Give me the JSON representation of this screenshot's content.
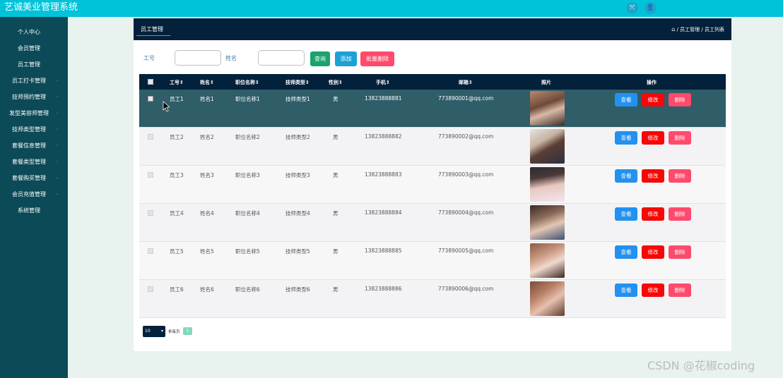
{
  "app": {
    "title": "艺诚美业管理系统"
  },
  "topbar": {
    "fullscreen_icon": "⤧",
    "user_icon": "👤"
  },
  "sidebar": {
    "items": [
      {
        "label": "个人中心"
      },
      {
        "label": "会员管理"
      },
      {
        "label": "员工管理"
      },
      {
        "label": "员工打卡管理"
      },
      {
        "label": "技师预约管理"
      },
      {
        "label": "发型美容师管理"
      },
      {
        "label": "技师类型管理"
      },
      {
        "label": "套餐信息管理"
      },
      {
        "label": "套餐类型管理"
      },
      {
        "label": "套餐购买管理"
      },
      {
        "label": "会员充值管理"
      },
      {
        "label": "系统管理"
      }
    ]
  },
  "panel": {
    "title": "员工管理",
    "breadcrumb": "/ 员工管理 / 员工列表"
  },
  "search": {
    "id_label": "工号",
    "name_label": "姓名",
    "id_value": "",
    "name_value": "",
    "search_btn": "查询",
    "add_btn": "添加",
    "batch_delete_btn": "批量删除"
  },
  "table": {
    "headers": [
      "工号",
      "姓名",
      "职位名称",
      "技师类型",
      "性别",
      "手机",
      "邮箱",
      "照片",
      "操作"
    ],
    "sort_marker": "⇕",
    "view_label": "查看",
    "edit_label": "修改",
    "delete_label": "删除",
    "rows": [
      {
        "id": "员工1",
        "name": "姓名1",
        "position": "职位名称1",
        "tech_type": "技师类型1",
        "gender": "男",
        "phone": "13823888881",
        "email": "773890001@qq.com"
      },
      {
        "id": "员工2",
        "name": "姓名2",
        "position": "职位名称2",
        "tech_type": "技师类型2",
        "gender": "男",
        "phone": "13823888882",
        "email": "773890002@qq.com"
      },
      {
        "id": "员工3",
        "name": "姓名3",
        "position": "职位名称3",
        "tech_type": "技师类型3",
        "gender": "男",
        "phone": "13823888883",
        "email": "773890003@qq.com"
      },
      {
        "id": "员工4",
        "name": "姓名4",
        "position": "职位名称4",
        "tech_type": "技师类型4",
        "gender": "男",
        "phone": "13823888884",
        "email": "773890004@qq.com"
      },
      {
        "id": "员工5",
        "name": "姓名5",
        "position": "职位名称5",
        "tech_type": "技师类型5",
        "gender": "男",
        "phone": "13823888885",
        "email": "773890005@qq.com"
      },
      {
        "id": "员工6",
        "name": "姓名6",
        "position": "职位名称6",
        "tech_type": "技师类型6",
        "gender": "男",
        "phone": "13823888886",
        "email": "773890006@qq.com"
      }
    ]
  },
  "pager": {
    "page_size": "10",
    "per_page_label": "条每页",
    "current_page": "1"
  },
  "watermark": "CSDN @花椒coding",
  "colors": {
    "topbar": "#00c3da",
    "sidebar": "#0b4a56",
    "header": "#03213b",
    "view": "#2391f0",
    "edit": "#f70707",
    "delete": "#fe4a6c",
    "search": "#1aa36b",
    "add": "#1ba1d6",
    "batch_delete": "#fe4a6c"
  }
}
